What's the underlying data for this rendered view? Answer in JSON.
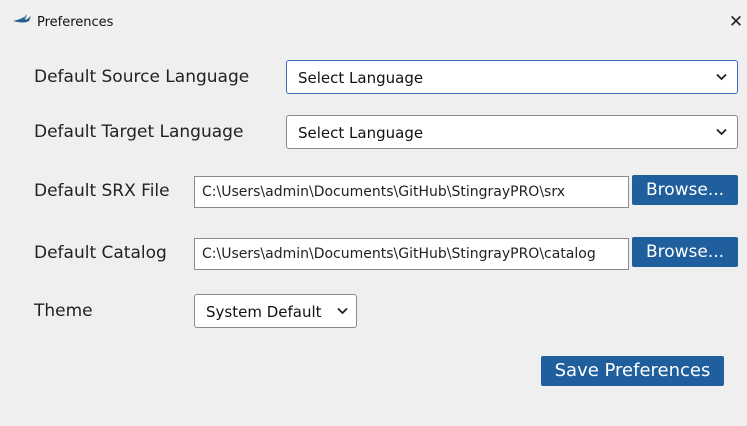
{
  "window": {
    "title": "Preferences",
    "close_glyph": "✕",
    "icon": "bird-icon"
  },
  "fields": {
    "source_language": {
      "label": "Default Source Language",
      "value": "Select Language"
    },
    "target_language": {
      "label": "Default Target Language",
      "value": "Select Language"
    },
    "srx_file": {
      "label": "Default SRX File",
      "value": "C:\\Users\\admin\\Documents\\GitHub\\StingrayPRO\\srx",
      "browse_label": "Browse..."
    },
    "catalog": {
      "label": "Default Catalog",
      "value": "C:\\Users\\admin\\Documents\\GitHub\\StingrayPRO\\catalog",
      "browse_label": "Browse..."
    },
    "theme": {
      "label": "Theme",
      "value": "System Default"
    }
  },
  "actions": {
    "save_label": "Save Preferences"
  },
  "colors": {
    "accent": "#1f5f9e",
    "background": "#efefef"
  }
}
